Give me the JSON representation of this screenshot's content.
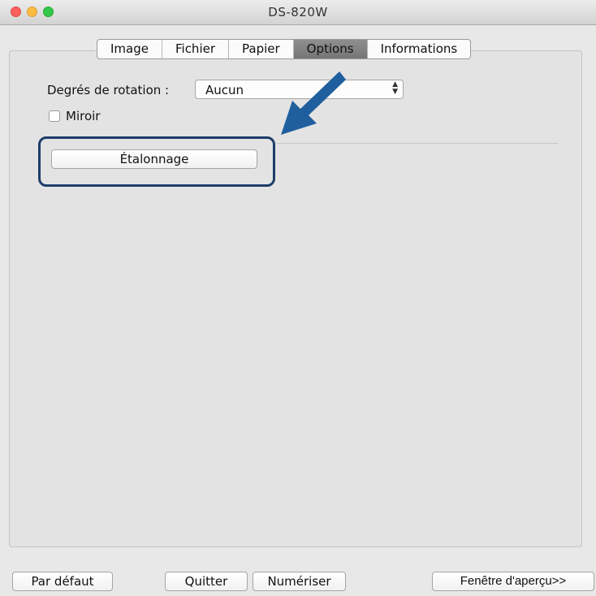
{
  "window": {
    "title": "DS-820W"
  },
  "tabs": [
    {
      "label": "Image",
      "active": false
    },
    {
      "label": "Fichier",
      "active": false
    },
    {
      "label": "Papier",
      "active": false
    },
    {
      "label": "Options",
      "active": true
    },
    {
      "label": "Informations",
      "active": false
    }
  ],
  "options": {
    "rotation_label": "Degrés de rotation :",
    "rotation_value": "Aucun",
    "mirror_label": "Miroir",
    "mirror_checked": false,
    "calibration_label": "Étalonnage"
  },
  "annotation": {
    "arrow_color": "#1f5f9e",
    "highlight_color": "#1d3e6a"
  },
  "footer": {
    "default_label": "Par défaut",
    "quit_label": "Quitter",
    "scan_label": "Numériser",
    "preview_label": "Fenêtre d'aperçu>>"
  }
}
